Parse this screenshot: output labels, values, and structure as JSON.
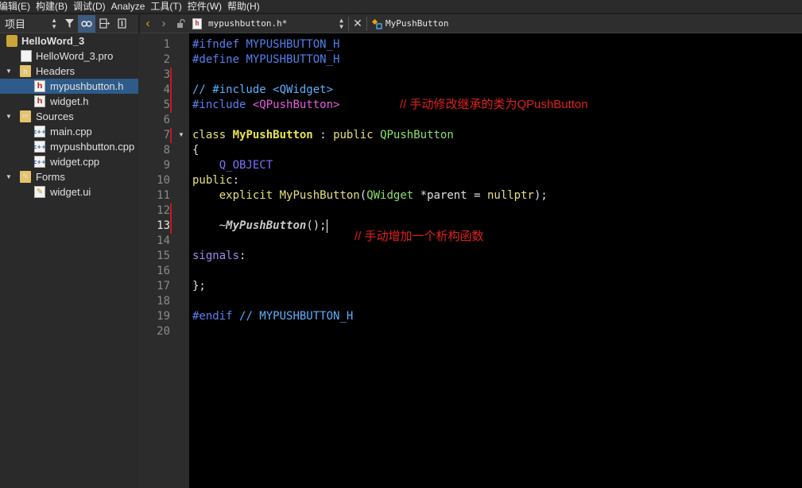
{
  "menu": [
    "编辑(E)",
    "构建(B)",
    "调试(D)",
    "Analyze",
    "工具(T)",
    "控件(W)",
    "帮助(H)"
  ],
  "project_panel": {
    "selector_label": "项目",
    "tree": {
      "project": "HelloWord_3",
      "pro_file": "HelloWord_3.pro",
      "headers_label": "Headers",
      "header_files": [
        "mypushbutton.h",
        "widget.h"
      ],
      "sources_label": "Sources",
      "source_files": [
        "main.cpp",
        "mypushbutton.cpp",
        "widget.cpp"
      ],
      "forms_label": "Forms",
      "form_files": [
        "widget.ui"
      ]
    }
  },
  "editor": {
    "document": "mypushbutton.h*",
    "symbol": "MyPushButton",
    "current_line": 13,
    "line_numbers": [
      "1",
      "2",
      "3",
      "4",
      "5",
      "6",
      "7",
      "8",
      "9",
      "10",
      "11",
      "12",
      "13",
      "14",
      "15",
      "16",
      "17",
      "18",
      "19",
      "20"
    ],
    "code": {
      "l1": [
        "#ifndef",
        "MYPUSHBUTTON_H"
      ],
      "l2": [
        "#define",
        "MYPUSHBUTTON_H"
      ],
      "l4": [
        "// #include <QWidget>"
      ],
      "l5": [
        "#include",
        "<QPushButton>"
      ],
      "l7": [
        "class",
        "MyPushButton",
        ":",
        "public",
        "QPushButton"
      ],
      "l8": [
        "{"
      ],
      "l9": [
        "Q_OBJECT"
      ],
      "l10": [
        "public",
        ":"
      ],
      "l11": [
        "explicit",
        "MyPushButton",
        "(",
        "QWidget",
        "*parent",
        "=",
        "nullptr",
        ");"
      ],
      "l13": [
        "~",
        "MyPushButton",
        "();"
      ],
      "l15": [
        "signals",
        ":"
      ],
      "l17": [
        "};"
      ],
      "l19": [
        "#endif",
        "// MYPUSHBUTTON_H"
      ]
    },
    "annotations": {
      "inherit_note": "// 手动修改继承的类为QPushButton",
      "dtor_note": "// 手动增加一个析构函数"
    }
  }
}
